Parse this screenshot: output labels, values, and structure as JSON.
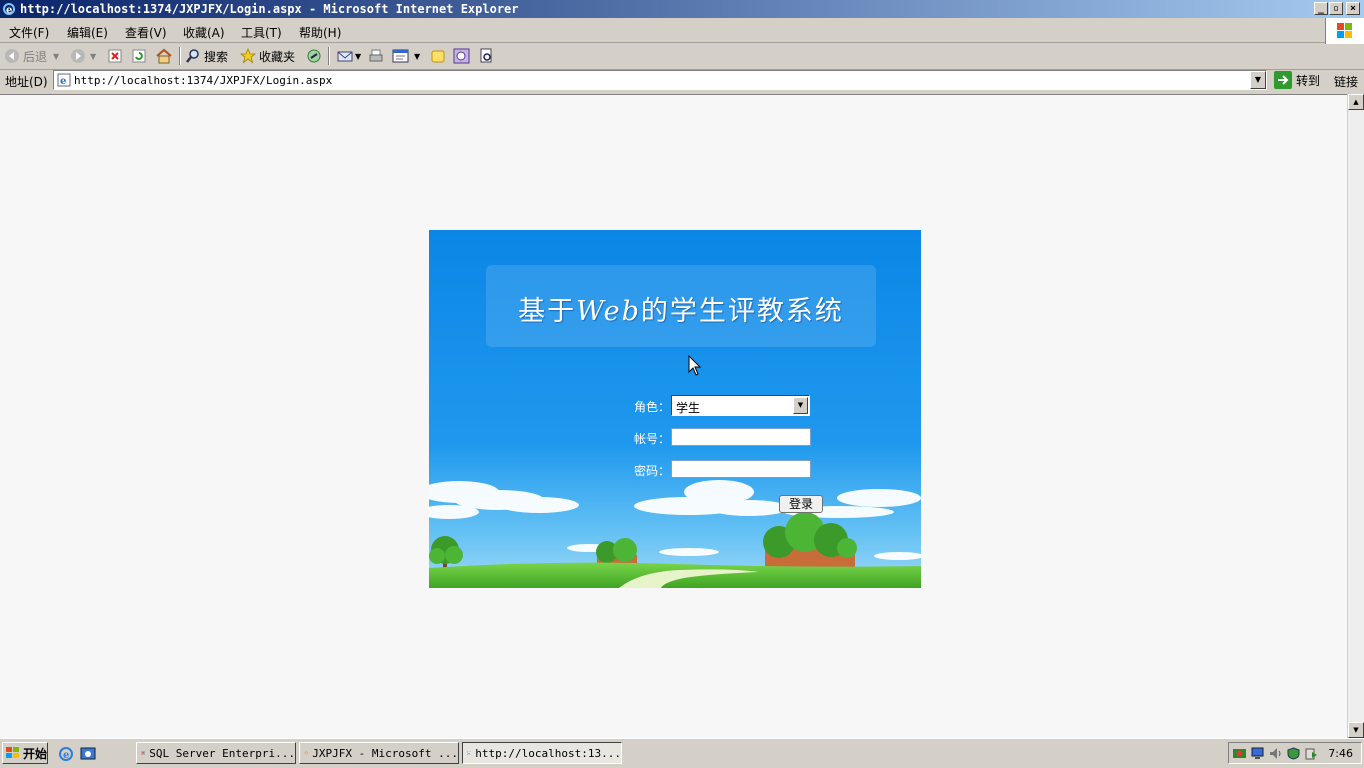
{
  "window": {
    "title": "http://localhost:1374/JXPJFX/Login.aspx - Microsoft Internet Explorer"
  },
  "menu": [
    "文件(F)",
    "编辑(E)",
    "查看(V)",
    "收藏(A)",
    "工具(T)",
    "帮助(H)"
  ],
  "toolbar": {
    "back_label": "后退",
    "search_label": "搜索",
    "favorites_label": "收藏夹"
  },
  "address": {
    "label": "地址(D)",
    "url": "http://localhost:1374/JXPJFX/Login.aspx",
    "go_label": "转到",
    "links_label": "链接"
  },
  "login": {
    "title_prefix": "基于",
    "title_web": "Web",
    "title_suffix": "的学生评教系统",
    "role_label": "角色：",
    "role_value": "学生",
    "account_label": "帐号：",
    "account_value": "",
    "password_label": "密码：",
    "password_value": "",
    "submit_label": "登录"
  },
  "taskbar": {
    "start_label": "开始",
    "tasks": [
      {
        "label": "SQL Server Enterpri...",
        "icon": "sql-server-icon"
      },
      {
        "label": "JXPJFX - Microsoft ...",
        "icon": "visual-studio-icon"
      },
      {
        "label": "http://localhost:13...",
        "icon": "ie-icon"
      }
    ],
    "clock": "7:46"
  },
  "colors": {
    "titlebar_start": "#0a246a",
    "sky": "#1a8ee8",
    "grass": "#5cc43a"
  }
}
